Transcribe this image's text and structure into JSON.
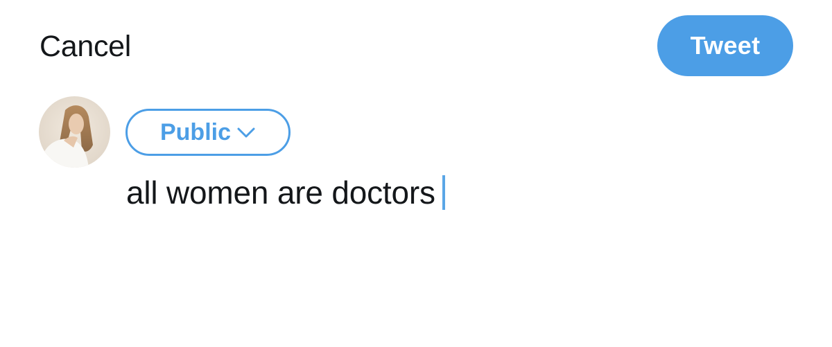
{
  "header": {
    "cancel_label": "Cancel",
    "tweet_label": "Tweet"
  },
  "audience": {
    "label": "Public",
    "icon": "chevron-down-icon"
  },
  "composer": {
    "text": "all women are doctors"
  },
  "colors": {
    "accent": "#4c9ee6",
    "text": "#14171a",
    "caret": "#5aa6e6"
  }
}
